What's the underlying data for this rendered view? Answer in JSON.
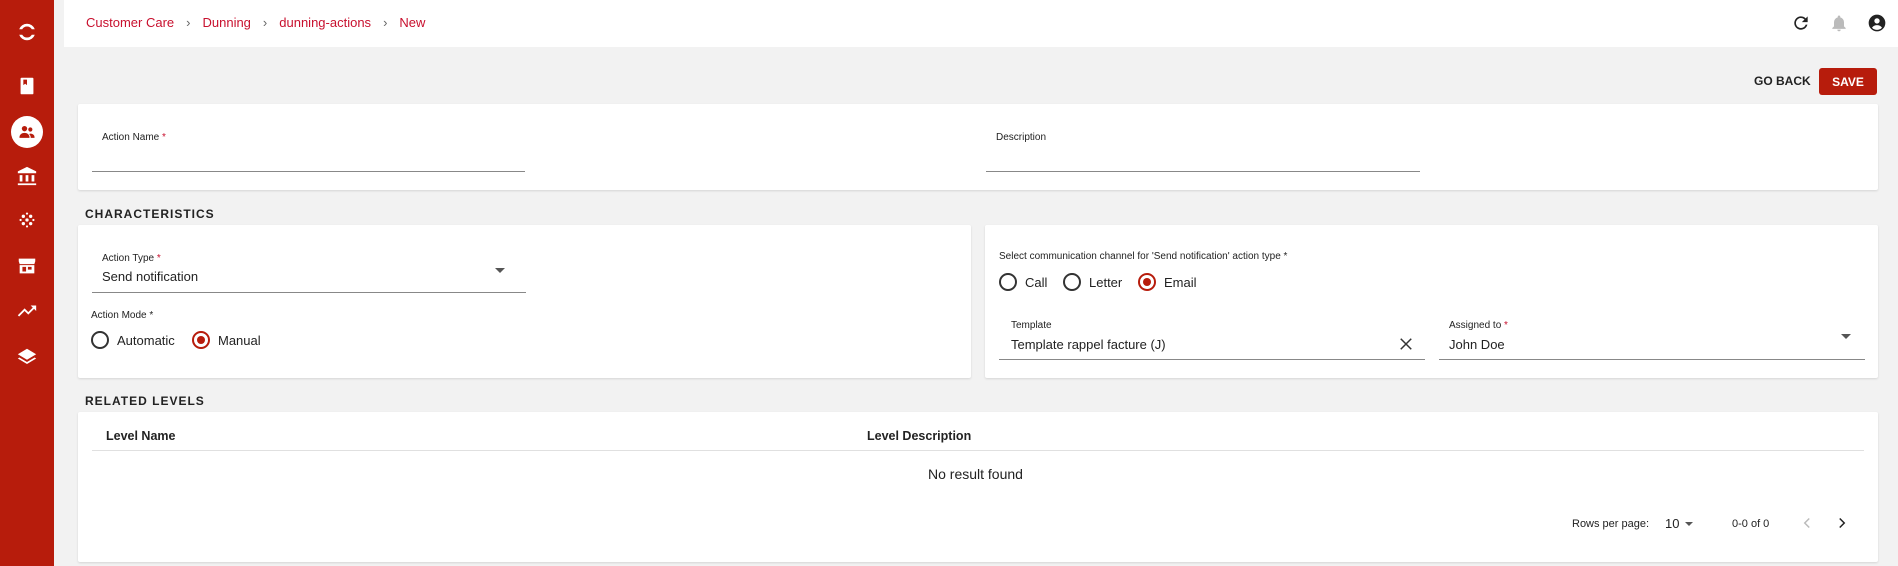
{
  "sidebar": {
    "items": [
      {
        "icon": "logo-icon"
      },
      {
        "icon": "book-icon"
      },
      {
        "icon": "customers-icon",
        "active": true
      },
      {
        "icon": "bank-icon"
      },
      {
        "icon": "dots-icon"
      },
      {
        "icon": "store-icon"
      },
      {
        "icon": "trending-icon"
      },
      {
        "icon": "layers-icon"
      }
    ]
  },
  "breadcrumb": [
    "Customer Care",
    "Dunning",
    "dunning-actions",
    "New"
  ],
  "header_icons": [
    "refresh-icon",
    "bell-icon",
    "account-icon"
  ],
  "toolbar": {
    "goback_label": "GO BACK",
    "save_label": "SAVE"
  },
  "general": {
    "action_name_label": "Action Name",
    "action_name_value": "",
    "description_label": "Description",
    "description_value": ""
  },
  "characteristics": {
    "title": "CHARACTERISTICS",
    "action_type_label": "Action Type",
    "action_type_value": "Send notification",
    "action_mode_label": "Action Mode *",
    "modes": [
      {
        "label": "Automatic",
        "checked": false
      },
      {
        "label": "Manual",
        "checked": true
      }
    ],
    "channel_label": "Select communication channel for 'Send notification' action type *",
    "channels": [
      {
        "label": "Call",
        "checked": false
      },
      {
        "label": "Letter",
        "checked": false
      },
      {
        "label": "Email",
        "checked": true
      }
    ],
    "template_label": "Template",
    "template_value": "Template rappel facture (J)",
    "assigned_label": "Assigned to",
    "assigned_value": "John Doe"
  },
  "related": {
    "title": "RELATED LEVELS",
    "columns": [
      "Level Name",
      "Level Description"
    ],
    "empty_text": "No result found",
    "rows_per_page_label": "Rows per page:",
    "rows_per_page_value": "10",
    "range_text": "0-0 of 0"
  },
  "colors": {
    "accent": "#b71c0c",
    "link": "#c8102e"
  }
}
